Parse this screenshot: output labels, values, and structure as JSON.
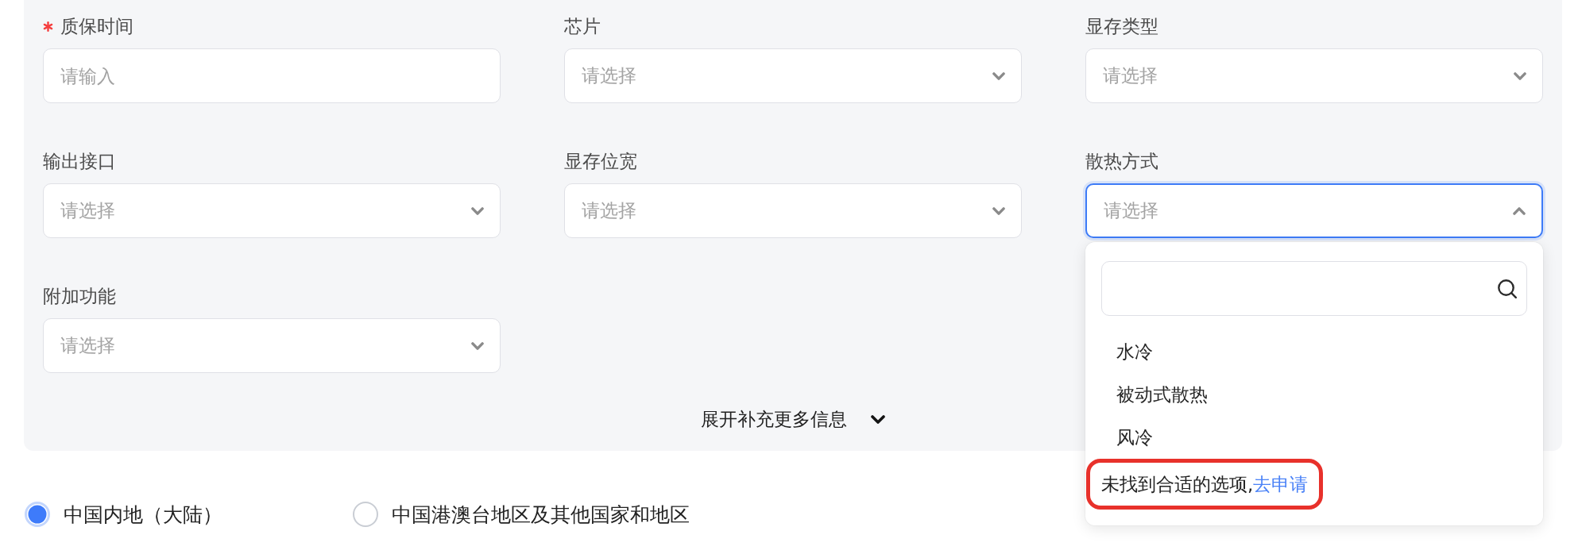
{
  "form": {
    "fields": [
      {
        "label": "质保时间",
        "required": true,
        "kind": "input",
        "placeholder": "请输入"
      },
      {
        "label": "芯片",
        "required": false,
        "kind": "select",
        "placeholder": "请选择",
        "expanded": false
      },
      {
        "label": "显存类型",
        "required": false,
        "kind": "select",
        "placeholder": "请选择",
        "expanded": false
      },
      {
        "label": "输出接口",
        "required": false,
        "kind": "select",
        "placeholder": "请选择",
        "expanded": false
      },
      {
        "label": "显存位宽",
        "required": false,
        "kind": "select",
        "placeholder": "请选择",
        "expanded": false
      },
      {
        "label": "散热方式",
        "required": false,
        "kind": "select",
        "placeholder": "请选择",
        "expanded": true
      },
      {
        "label": "附加功能",
        "required": false,
        "kind": "select",
        "placeholder": "请选择",
        "expanded": false
      }
    ],
    "expand_toggle": {
      "label": "展开补充更多信息",
      "expanded": false
    }
  },
  "dropdown": {
    "options": [
      {
        "label": "水冷",
        "selected": false
      },
      {
        "label": "被动式散热",
        "selected": false
      },
      {
        "label": "风冷",
        "selected": false
      }
    ],
    "footer": {
      "message": "未找到合适的选项,",
      "link": "去申请",
      "highlighted": true
    }
  },
  "region": {
    "options": [
      {
        "label": "中国内地（大陆）",
        "selected": true
      },
      {
        "label": "中国港澳台地区及其他国家和地区",
        "selected": false
      }
    ]
  }
}
